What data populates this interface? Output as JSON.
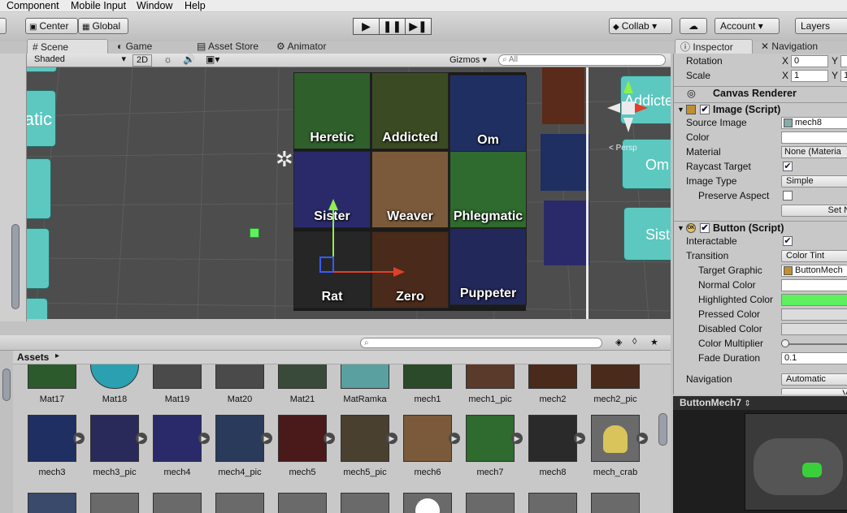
{
  "menu": {
    "component": "Component",
    "mobile_input": "Mobile Input",
    "window": "Window",
    "help": "Help"
  },
  "toolbar": {
    "center": "Center",
    "global": "Global",
    "collab": "Collab",
    "account": "Account",
    "layers": "Layers"
  },
  "scene_tabs": {
    "scene": "Scene",
    "game": "Game",
    "asset_store": "Asset Store",
    "animator": "Animator"
  },
  "scene_toolbar": {
    "shading": "Shaded",
    "mode_2d": "2D",
    "gizmos": "Gizmos",
    "search_placeholder": "All"
  },
  "scene": {
    "grid": [
      {
        "label": "Heretic",
        "color": "#2f5f2a"
      },
      {
        "label": "Addicted",
        "color": "#3a4a22"
      },
      {
        "label": "Om",
        "color": "#1f2f62"
      },
      {
        "label": "Sister",
        "color": "#2a2a6a"
      },
      {
        "label": "Weaver",
        "color": "#7a5a3a"
      },
      {
        "label": "Phlegmatic",
        "color": "#2f6a2f"
      },
      {
        "label": "Rat",
        "color": "#262626"
      },
      {
        "label": "Zero",
        "color": "#4a2a1a"
      },
      {
        "label": "Puppeter",
        "color": "#22285a"
      }
    ],
    "left_button_fragment": "atic",
    "right_labels": {
      "addicted": "Addicte",
      "om": "Om",
      "sister": "Siste"
    },
    "persp": "< Persp"
  },
  "assets": {
    "breadcrumb": "Assets",
    "row1": [
      {
        "name": "Mat17",
        "color": "#2c5a2c"
      },
      {
        "name": "Mat18",
        "color": "#2aa0b0"
      },
      {
        "name": "Mat19",
        "color": "#4a4a4a"
      },
      {
        "name": "Mat20",
        "color": "#4a4a4a"
      },
      {
        "name": "Mat21",
        "color": "#3a4a3a"
      },
      {
        "name": "MatRamka",
        "color": "#5aa0a0"
      },
      {
        "name": "mech1",
        "color": "#2a4a2a"
      },
      {
        "name": "mech1_pic",
        "color": "#5a3a2a"
      },
      {
        "name": "mech2",
        "color": "#4a2a1a"
      },
      {
        "name": "mech2_pic",
        "color": "#4a2a1a"
      }
    ],
    "row2": [
      {
        "name": "mech3",
        "color": "#1f2f62"
      },
      {
        "name": "mech3_pic",
        "color": "#2a2a5a"
      },
      {
        "name": "mech4",
        "color": "#2a2a6a"
      },
      {
        "name": "mech4_pic",
        "color": "#2a3a5a"
      },
      {
        "name": "mech5",
        "color": "#4a1a1a"
      },
      {
        "name": "mech5_pic",
        "color": "#4a4030"
      },
      {
        "name": "mech6",
        "color": "#7a5a3a"
      },
      {
        "name": "mech7",
        "color": "#2f6a2f"
      },
      {
        "name": "mech8",
        "color": "#2a2a2a"
      },
      {
        "name": "mech_crab",
        "color": "#c0b060"
      }
    ]
  },
  "inspector": {
    "tabs": {
      "inspector": "Inspector",
      "navigation": "Navigation"
    },
    "rotation": {
      "label": "Rotation",
      "x_label": "X",
      "x": "0",
      "y_label": "Y"
    },
    "scale": {
      "label": "Scale",
      "x_label": "X",
      "x": "1",
      "y_label": "Y",
      "y": "1"
    },
    "canvas_renderer": "Canvas Renderer",
    "image_script": {
      "title": "Image (Script)",
      "source_image_label": "Source Image",
      "source_image": "mech8",
      "color_label": "Color",
      "material_label": "Material",
      "material": "None (Materia",
      "raycast_label": "Raycast Target",
      "image_type_label": "Image Type",
      "image_type": "Simple",
      "preserve_label": "Preserve Aspect",
      "set_native": "Set N"
    },
    "button_script": {
      "title": "Button (Script)",
      "interactable_label": "Interactable",
      "transition_label": "Transition",
      "transition": "Color Tint",
      "target_graphic_label": "Target Graphic",
      "target_graphic": "ButtonMech",
      "normal_label": "Normal Color",
      "highlighted_label": "Highlighted Color",
      "pressed_label": "Pressed Color",
      "disabled_label": "Disabled Color",
      "multiplier_label": "Color Multiplier",
      "fade_label": "Fade Duration",
      "fade": "0.1"
    },
    "navigation_label": "Navigation",
    "navigation": "Automatic",
    "visualize": "Vi"
  },
  "preview": {
    "title": "ButtonMech7"
  },
  "colors": {
    "normal": "#ffffff",
    "highlighted": "#5ef05e",
    "pressed": "#c8c8c8",
    "disabled": "#c8c8c8"
  }
}
